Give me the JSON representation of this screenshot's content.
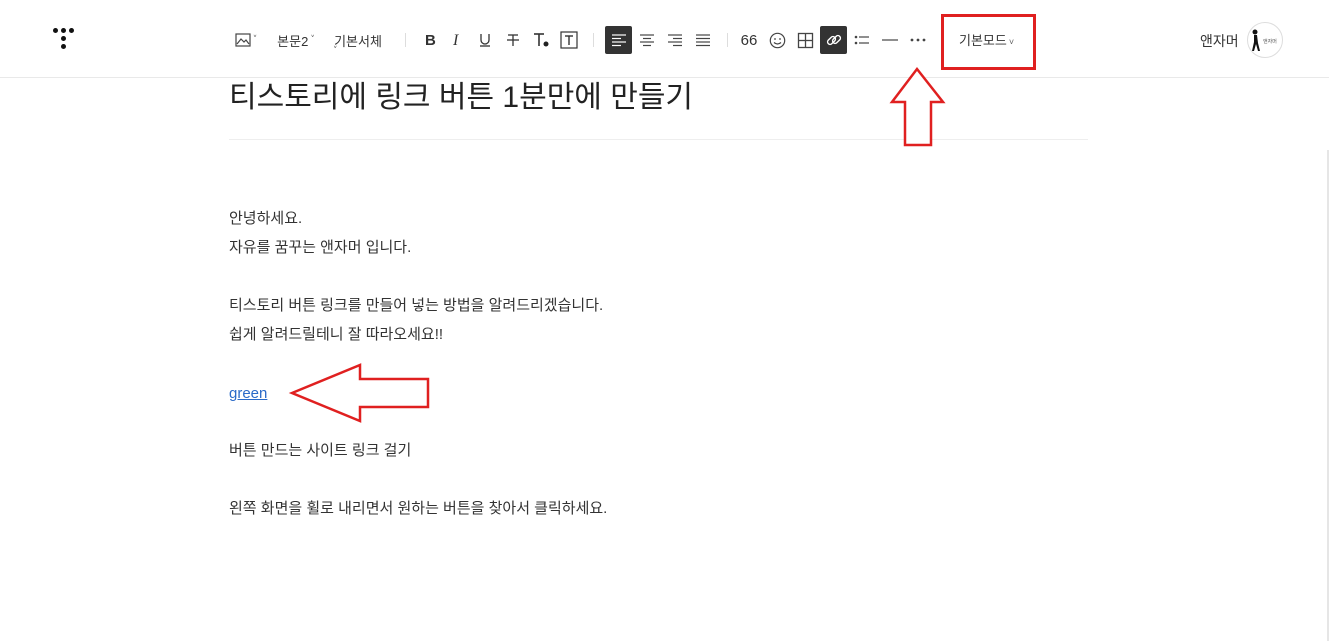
{
  "toolbar": {
    "paragraph_style": "본문2",
    "font_family": "기본서체",
    "quote_label": "66",
    "mode": "기본모드"
  },
  "user": {
    "name": "앤자머"
  },
  "post": {
    "title": "티스토리에 링크 버튼 1분만에 만들기",
    "lines": [
      "안녕하세요.",
      "자유를 꿈꾸는 앤자머 입니다.",
      "티스토리 버튼 링크를 만들어 넣는 방법을 알려드리겠습니다.",
      "쉽게 알려드릴테니 잘 따라오세요!!",
      "버튼 만드는 사이트 링크 걸기",
      "왼쪽 화면을 휠로 내리면서 원하는 버튼을 찾아서 클릭하세요."
    ],
    "link_text": "green"
  },
  "colors": {
    "annotation": "#e02020",
    "link": "#2a6ac8"
  },
  "icons": [
    "logo-icon",
    "image-icon",
    "bold-icon",
    "italic-icon",
    "underline-icon",
    "strikethrough-icon",
    "text-color-icon",
    "background-color-icon",
    "align-left-icon",
    "align-center-icon",
    "align-right-icon",
    "align-justify-icon",
    "quote-icon",
    "emoji-icon",
    "table-icon",
    "link-icon",
    "list-icon",
    "divider-icon",
    "more-icon"
  ]
}
